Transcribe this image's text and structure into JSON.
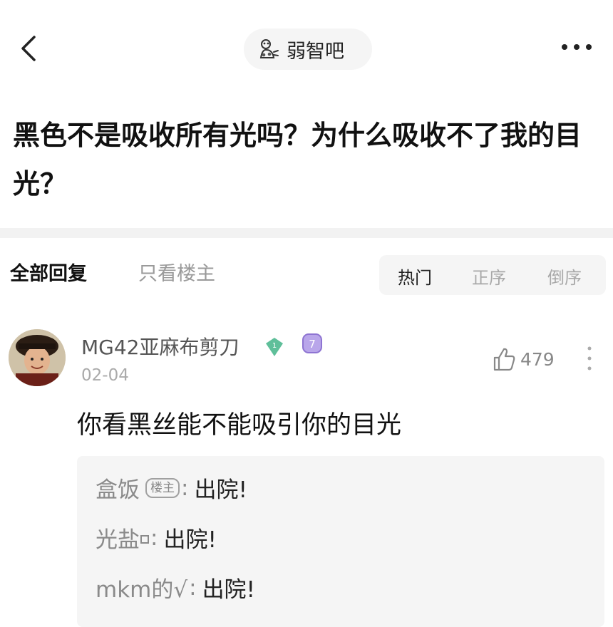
{
  "header": {
    "forum_name": "弱智吧",
    "back_icon": "chevron-left-icon",
    "more_icon": "more-horizontal-icon",
    "forum_icon": "forum-mascot-icon"
  },
  "thread": {
    "title": "黑色不是吸收所有光吗？为什么吸收不了我的目光？"
  },
  "filters": {
    "all_replies": "全部回复",
    "only_op": "只看楼主",
    "sort_hot": "热门",
    "sort_asc": "正序",
    "sort_desc": "倒序"
  },
  "reply": {
    "username": "MG42亚麻布剪刀",
    "level_badge": "1",
    "grade_badge": "7",
    "date": "02-04",
    "likes": "479",
    "text": "你看黑丝能不能吸引你的目光",
    "sub_replies": [
      {
        "user": "盒饭",
        "tag": "楼主",
        "text": "出院!"
      },
      {
        "user": "光盐",
        "tag": "",
        "text": "出院!"
      },
      {
        "user": "mkm的√",
        "tag": "",
        "text": "出院!"
      }
    ]
  },
  "colors": {
    "badge_green": "#5fbf9a",
    "badge_purple": "#9b7fd8"
  }
}
